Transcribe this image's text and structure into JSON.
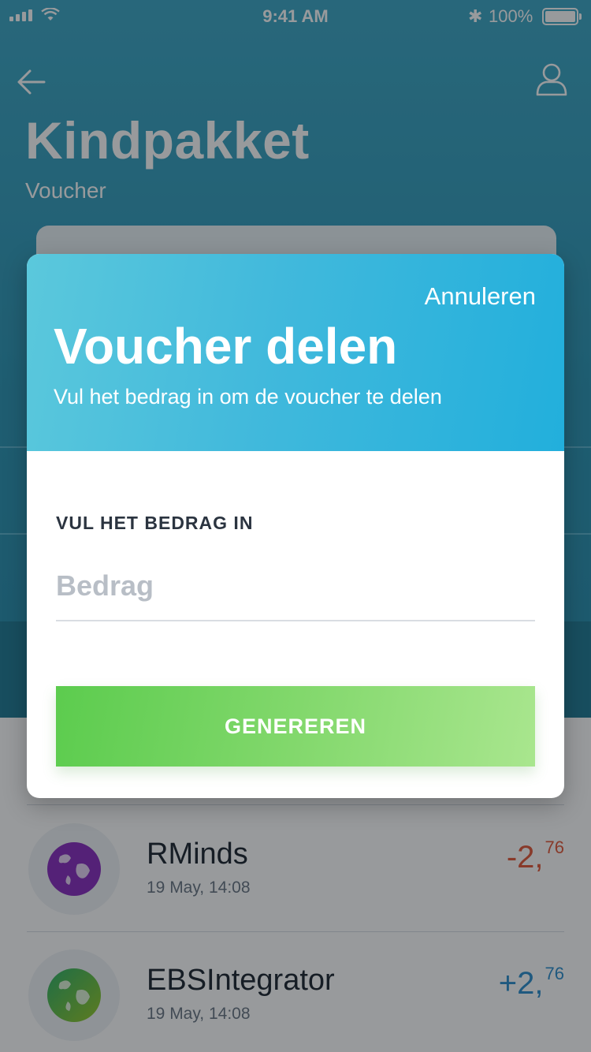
{
  "status_bar": {
    "time": "9:41 AM",
    "battery": "100%"
  },
  "background": {
    "title": "Kindpakket",
    "subtitle": "Voucher",
    "transactions": [
      {
        "name": "RMinds",
        "date": "19 May, 14:08",
        "amount_main": "-2,",
        "amount_cents": "76",
        "direction": "negative",
        "avatar_color": "#8a2fbf"
      },
      {
        "name": "EBSIntegrator",
        "date": "19 May, 14:08",
        "amount_main": "+2,",
        "amount_cents": "76",
        "direction": "positive",
        "avatar_color": "#55b84a"
      }
    ]
  },
  "modal": {
    "cancel_label": "Annuleren",
    "title": "Voucher delen",
    "subtitle": "Vul het bedrag in om de voucher te delen",
    "field_label": "VUL HET BEDRAG IN",
    "amount_placeholder": "Bedrag",
    "amount_value": "",
    "generate_label": "GENEREREN"
  },
  "colors": {
    "header_gradient_start": "#5bc8dc",
    "header_gradient_end": "#22afdc",
    "button_gradient_start": "#5ccc4e",
    "button_gradient_end": "#a9e68e",
    "negative_amount": "#e35a3b",
    "positive_amount": "#2f8fce"
  },
  "icons": [
    "signal-icon",
    "wifi-icon",
    "bluetooth-icon",
    "battery-icon",
    "back-arrow-icon",
    "profile-icon",
    "globe-icon"
  ]
}
